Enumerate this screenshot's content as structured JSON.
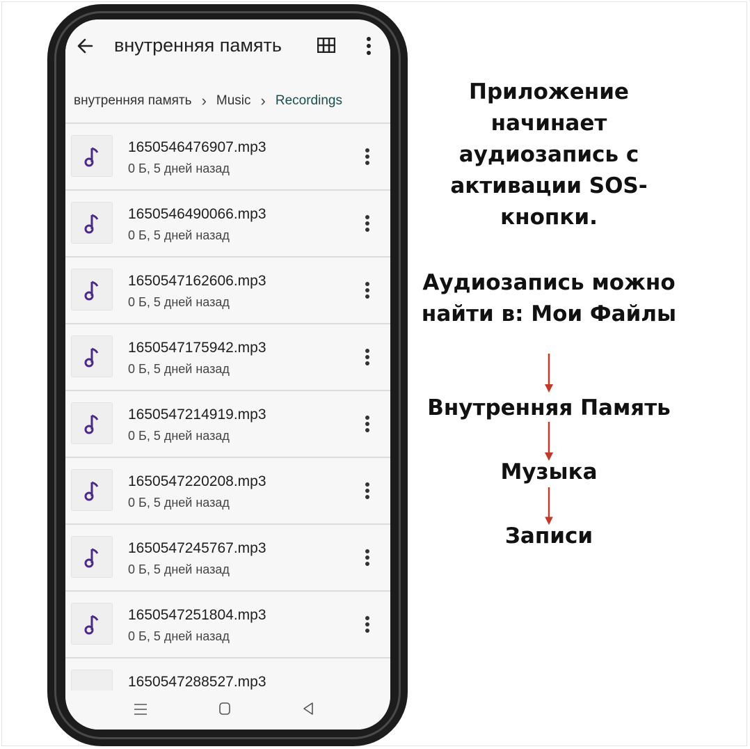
{
  "app": {
    "title": "внутренняя память",
    "breadcrumb": [
      "внутренняя память",
      "Music",
      "Recordings"
    ]
  },
  "files": [
    {
      "name": "1650546476907.mp3",
      "meta": "0 Б, 5 дней назад"
    },
    {
      "name": "1650546490066.mp3",
      "meta": "0 Б, 5 дней назад"
    },
    {
      "name": "1650547162606.mp3",
      "meta": "0 Б, 5 дней назад"
    },
    {
      "name": "1650547175942.mp3",
      "meta": "0 Б, 5 дней назад"
    },
    {
      "name": "1650547214919.mp3",
      "meta": "0 Б, 5 дней назад"
    },
    {
      "name": "1650547220208.mp3",
      "meta": "0 Б, 5 дней назад"
    },
    {
      "name": "1650547245767.mp3",
      "meta": "0 Б, 5 дней назад"
    },
    {
      "name": "1650547251804.mp3",
      "meta": "0 Б, 5 дней назад"
    },
    {
      "name": "1650547288527.mp3",
      "meta": ""
    }
  ],
  "panel": {
    "intro": "Приложение начинает аудиозапись с активации SOS-кнопки.",
    "howto": "Аудиозапись можно найти в: Мои Файлы",
    "steps": [
      "Внутренняя Память",
      "Музыка",
      "Записи"
    ]
  },
  "colors": {
    "accent_note": "#4a2a8a",
    "arrow": "#c0392b",
    "active_crumb": "#1a4d4d"
  }
}
